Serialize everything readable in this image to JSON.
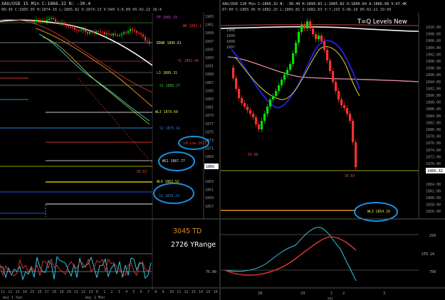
{
  "left_chart": {
    "header_line1": "XAU/USD 15 Min C:1866.32 N: -30.4",
    "header_line2": "08:30 C:1865.95 H:1874.16 L:1865.82 O:1874.13 V:949 S:6.09 05-02-22 16:4",
    "price_labels": [
      "1903",
      "1901",
      "1899",
      "1897",
      "1895",
      "1893",
      "1891",
      "1889",
      "1887",
      "1885",
      "1883",
      "1881",
      "1879",
      "1877",
      "1875",
      "1873",
      "1871",
      "1869",
      "1867",
      "1866",
      "1863",
      "1861",
      "1859",
      "1857"
    ],
    "level_labels": {
      "pp": "PP 1902.33",
      "wk": "WK 1901.1",
      "rdwk": "RDWK 1896.81",
      "yl": "YL 1892.49",
      "l3": "L3 1889.31",
      "s1": "S1 1886.27",
      "wl3": "WL3 1879.69",
      "s2": "S2 1875.14",
      "lalow": "LR Low 1871",
      "ws1": "WS1 1867.77",
      "neg": "- 30.63",
      "wl4": "WL4 1862.52",
      "s3": "S3 1859.24"
    },
    "indicator_labels": {
      "td": "3045 TD",
      "yrange": "2726 YRange",
      "osc": "75.00"
    },
    "time_labels": [
      "11",
      "12",
      "13",
      "14",
      "15",
      "16",
      "17",
      "18",
      "19",
      "20",
      "21",
      "22",
      "23",
      "0",
      "1",
      "2",
      "3",
      "4",
      "5",
      "6",
      "7",
      "8",
      "9",
      "10",
      "11",
      "12",
      "13",
      "14",
      "15",
      "16"
    ],
    "date_labels": [
      "maj 1 Sun",
      "maj 2 Mon"
    ]
  },
  "right_chart": {
    "header_line1": "XAU/USD 120 Min C:1866.32 N: -30.49 H:1899.83 L:1865.82 O:1896.64 A:1866.68 V:47.4K",
    "header_line2": "07:00 C:1865.95 H:1882.25 L:1865.82 O:1882.03 V:7,193 S:96.10 05-02-22 19:56",
    "title": "T=Q Levels New",
    "price_labels": [
      "1910.00",
      "1908.00",
      "1906.00",
      "1904.00",
      "1902.00",
      "1900.00",
      "1898.00",
      "1896.00",
      "1894.00",
      "1892.00",
      "1890.00",
      "1888.00",
      "1886.00",
      "1884.00",
      "1882.00",
      "1880.00",
      "1878.00",
      "1876.00",
      "1874.00",
      "1872.00",
      "1870.00",
      "1868.00",
      "1866.32",
      "1864.00",
      "1862.00",
      "1860.00",
      "1858.00",
      "1856.00"
    ],
    "left_axis_labels": [
      "1900",
      "1899",
      "1898",
      "1897"
    ],
    "level_labels": {
      "neg1": "- 30.08",
      "neg2": "- 30.69",
      "wl3": "WL3 1854.10"
    },
    "indicator_labels": {
      "v250": "250",
      "sto": "STO 24",
      "v750": "750"
    },
    "date_labels": [
      "28",
      "29",
      "1",
      "maj",
      "2",
      "3"
    ]
  },
  "colors": {
    "bull": "#00e000",
    "bear": "#ff3030",
    "highlight": "#1a8fe0",
    "orange": "#e08a20",
    "gray_axis": "#9a9a9a"
  }
}
